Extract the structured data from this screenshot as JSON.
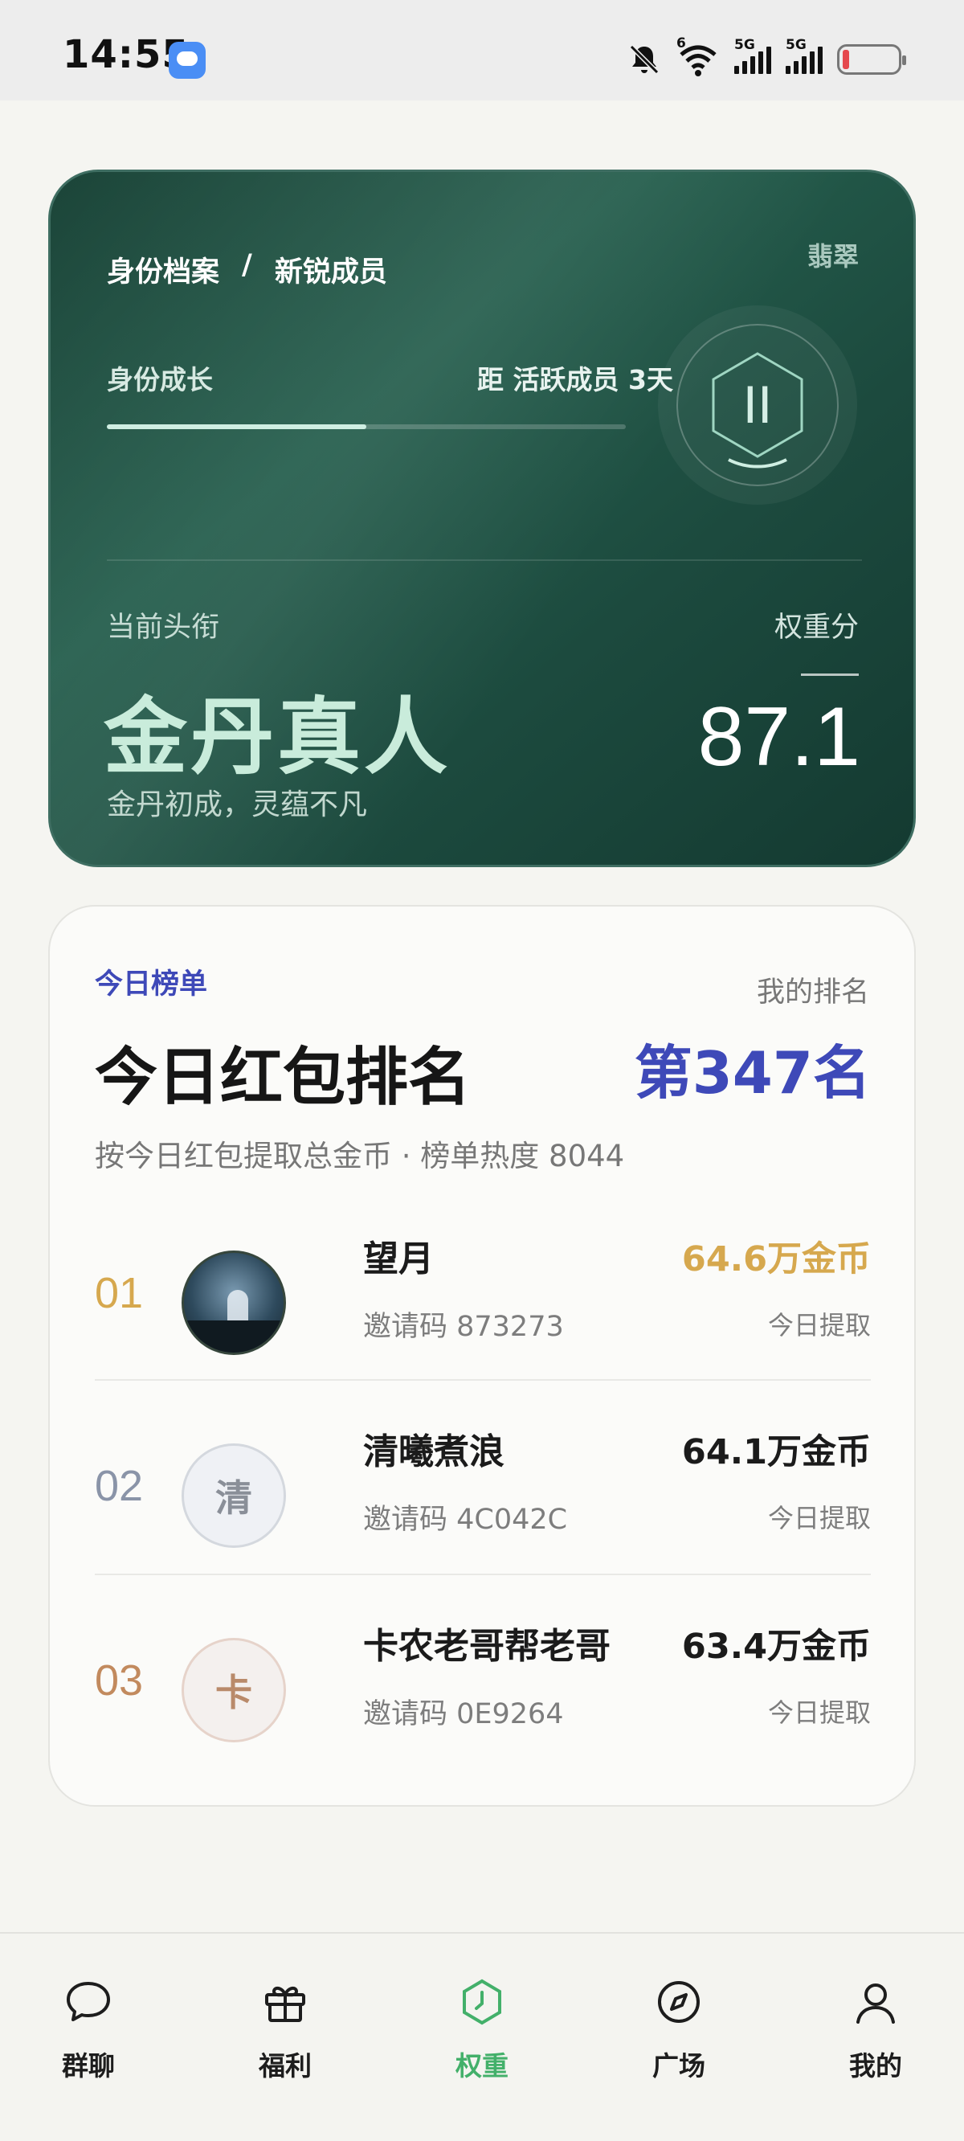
{
  "status_bar": {
    "time": "14:55",
    "net1": "6",
    "net2": "5G",
    "net3": "5G"
  },
  "identity": {
    "breadcrumb_left": "身份档案",
    "breadcrumb_sep": "/",
    "breadcrumb_right": "新锐成员",
    "tier": "翡翠",
    "growth_label": "身份成长",
    "growth_next": "距 活跃成员 3天",
    "growth_progress": 0.5,
    "current_title_label": "当前头衔",
    "current_title": "金丹真人",
    "current_title_sub": "金丹初成，灵蕴不凡",
    "weight_label": "权重分",
    "weight_score": "87.1",
    "badge_glyph": "II",
    "accent": "#c9ecdb"
  },
  "ranking": {
    "tag": "今日榜单",
    "my_rank_label": "我的排名",
    "title": "今日红包排名",
    "my_rank": "第347名",
    "desc": "按今日红包提取总金币 · 榜单热度 8044",
    "rows": [
      {
        "rank": "01",
        "name": "望月",
        "code": "邀请码  873273",
        "amount": "64.6万金币",
        "sub": "今日提取",
        "avatar_text": ""
      },
      {
        "rank": "02",
        "name": "清曦煮浪",
        "code": "邀请码  4C042C",
        "amount": "64.1万金币",
        "sub": "今日提取",
        "avatar_text": "清"
      },
      {
        "rank": "03",
        "name": "卡农老哥帮老哥",
        "code": "邀请码  0E9264",
        "amount": "63.4万金币",
        "sub": "今日提取",
        "avatar_text": "卡"
      }
    ],
    "colors": {
      "gold": "#d6a84e",
      "silver": "#8a94a8",
      "bronze": "#c28a5e",
      "accent": "#3e49b8"
    }
  },
  "nav": {
    "items": [
      {
        "label": "群聊",
        "icon": "chat-bubble-icon"
      },
      {
        "label": "福利",
        "icon": "gift-icon"
      },
      {
        "label": "权重",
        "icon": "weight-hexagon-icon"
      },
      {
        "label": "广场",
        "icon": "compass-icon"
      },
      {
        "label": "我的",
        "icon": "person-icon"
      }
    ],
    "active_color": "#43b06a"
  }
}
